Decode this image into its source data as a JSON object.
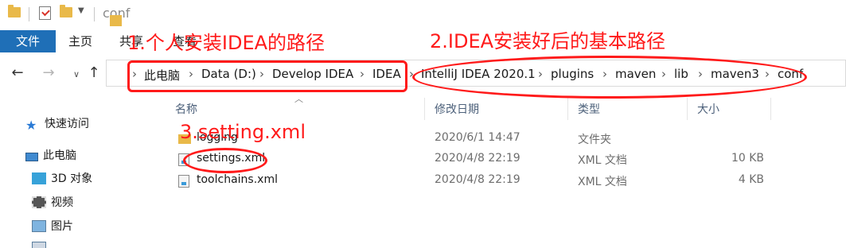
{
  "window": {
    "title": "conf"
  },
  "ribbon": {
    "tabs": {
      "file": "文件",
      "home": "主页",
      "share": "共享",
      "view": "查看"
    }
  },
  "nav": {
    "back_icon": "arrow-left-icon",
    "forward_icon": "arrow-right-icon",
    "recent_icon": "chevron-down-icon",
    "up_icon": "arrow-up-icon"
  },
  "breadcrumbs": [
    "此电脑",
    "Data (D:)",
    "Develop IDEA",
    "IDEA",
    "IntelliJ IDEA 2020.1",
    "plugins",
    "maven",
    "lib",
    "maven3",
    "conf"
  ],
  "sidebar": {
    "items": [
      {
        "label": "快速访问",
        "icon": "star-icon"
      },
      {
        "label": "此电脑",
        "icon": "computer-icon"
      },
      {
        "label": "3D 对象",
        "icon": "cube-icon"
      },
      {
        "label": "视频",
        "icon": "film-icon"
      },
      {
        "label": "图片",
        "icon": "picture-icon"
      }
    ]
  },
  "filelist": {
    "columns": {
      "name": "名称",
      "modified": "修改日期",
      "type": "类型",
      "size": "大小"
    },
    "rows": [
      {
        "name": "logging",
        "modified": "2020/6/1 14:47",
        "type": "文件夹",
        "size": ""
      },
      {
        "name": "settings.xml",
        "modified": "2020/4/8 22:19",
        "type": "XML 文档",
        "size": "10 KB"
      },
      {
        "name": "toolchains.xml",
        "modified": "2020/4/8 22:19",
        "type": "XML 文档",
        "size": "4 KB"
      }
    ]
  },
  "annotations": {
    "a1": "1.个人安装IDEA的路径",
    "a2": "2.IDEA安装好后的基本路径",
    "a3": "3.setting.xml",
    "color": "#ff1a1a"
  },
  "colors": {
    "accent": "#1f6fb7",
    "folder": "#e9b949"
  }
}
